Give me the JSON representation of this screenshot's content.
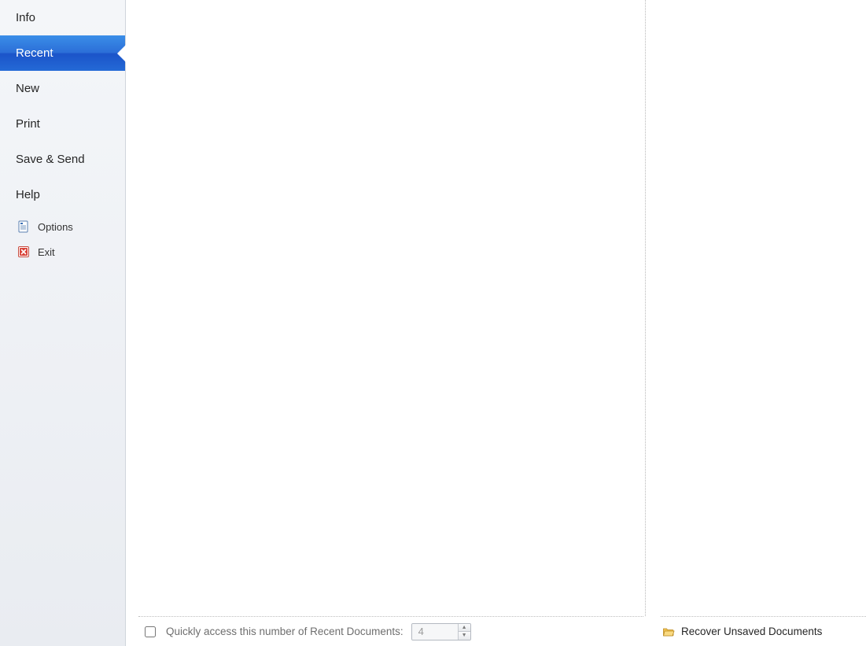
{
  "sidebar": {
    "items": [
      {
        "label": "Info",
        "selected": false
      },
      {
        "label": "Recent",
        "selected": true
      },
      {
        "label": "New",
        "selected": false
      },
      {
        "label": "Print",
        "selected": false
      },
      {
        "label": "Save & Send",
        "selected": false
      },
      {
        "label": "Help",
        "selected": false
      }
    ],
    "sub_items": [
      {
        "label": "Options",
        "icon": "options-icon"
      },
      {
        "label": "Exit",
        "icon": "exit-icon"
      }
    ]
  },
  "footer": {
    "quick_access_label": "Quickly access this number of Recent Documents:",
    "quick_access_value": "4",
    "quick_access_checked": false,
    "recover_label": "Recover Unsaved Documents"
  }
}
